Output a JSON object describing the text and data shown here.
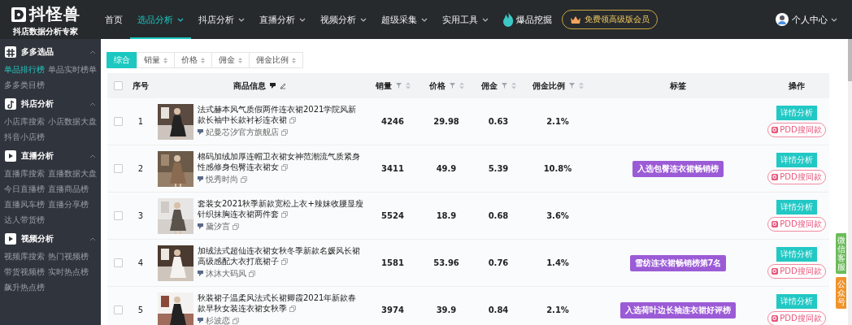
{
  "header": {
    "logo": {
      "title": "抖怪兽",
      "subtitle": "抖店数据分析专家"
    },
    "nav": [
      {
        "label": "首页",
        "selected": false,
        "dropdown": false
      },
      {
        "label": "选品分析",
        "selected": true,
        "dropdown": true
      },
      {
        "label": "抖店分析",
        "selected": false,
        "dropdown": true
      },
      {
        "label": "直播分析",
        "selected": false,
        "dropdown": true
      },
      {
        "label": "视频分析",
        "selected": false,
        "dropdown": true
      },
      {
        "label": "超级采集",
        "selected": false,
        "dropdown": true
      },
      {
        "label": "实用工具",
        "selected": false,
        "dropdown": true
      }
    ],
    "hot_link": "爆品挖掘",
    "vip_button": "免费领高级版会员",
    "user": "个人中心"
  },
  "sidebar": [
    {
      "title": "多多选品",
      "expanded": true,
      "items": [
        {
          "label": "单品排行榜",
          "selected": true
        },
        {
          "label": "单品实时榜单",
          "selected": false
        },
        {
          "label": "多多类目榜",
          "selected": false
        }
      ]
    },
    {
      "title": "抖店分析",
      "expanded": true,
      "items": [
        {
          "label": "小店库搜索",
          "selected": false
        },
        {
          "label": "小店数据大盘",
          "selected": false
        },
        {
          "label": "抖音小店榜",
          "selected": false
        }
      ]
    },
    {
      "title": "直播分析",
      "expanded": true,
      "items": [
        {
          "label": "直播库搜索",
          "selected": false
        },
        {
          "label": "直播数据大盘",
          "selected": false
        },
        {
          "label": "今日直播榜",
          "selected": false
        },
        {
          "label": "直播商品榜",
          "selected": false
        },
        {
          "label": "直播风车榜",
          "selected": false
        },
        {
          "label": "直播分享榜",
          "selected": false
        },
        {
          "label": "达人带货榜",
          "selected": false
        }
      ]
    },
    {
      "title": "视频分析",
      "expanded": true,
      "items": [
        {
          "label": "视频库搜索",
          "selected": false
        },
        {
          "label": "热门视频榜",
          "selected": false
        },
        {
          "label": "带货视频榜",
          "selected": false
        },
        {
          "label": "实时热点榜",
          "selected": false
        },
        {
          "label": "飙升热点榜",
          "selected": false
        }
      ]
    }
  ],
  "sort_tabs": [
    {
      "label": "综合",
      "selected": true,
      "sortable": false
    },
    {
      "label": "销量",
      "selected": false,
      "sortable": true
    },
    {
      "label": "价格",
      "selected": false,
      "sortable": true
    },
    {
      "label": "佣金",
      "selected": false,
      "sortable": true
    },
    {
      "label": "佣金比例",
      "selected": false,
      "sortable": true
    }
  ],
  "table": {
    "all_checked": false,
    "columns": [
      {
        "label": "序号",
        "kind": "plain"
      },
      {
        "label": "商品信息",
        "kind": "info"
      },
      {
        "label": "销量",
        "kind": "filter"
      },
      {
        "label": "价格",
        "kind": "filter"
      },
      {
        "label": "佣金",
        "kind": "filter"
      },
      {
        "label": "佣金比例",
        "kind": "filter"
      },
      {
        "label": "标签",
        "kind": "plain"
      },
      {
        "label": "操作",
        "kind": "plain"
      }
    ],
    "rows": [
      {
        "checked": false,
        "index": "1",
        "title": "法式赫本风气质假两件连衣裙2021学院风新款长袖中长款衬衫连衣裙",
        "shop": "妃曼芯汐官方旗舰店",
        "sales": "4246",
        "price": "29.98",
        "commission": "0.63",
        "ratio": "2.1%",
        "actions": [
          "详情分析",
          "PDD搜同款"
        ]
      },
      {
        "checked": false,
        "index": "2",
        "title": "棉码加绒加厚连帽卫衣裙女神范潮流气质紧身性感修身包臀连衣裙女",
        "shop": "悦秀时尚",
        "sales": "3411",
        "price": "49.9",
        "commission": "5.39",
        "ratio": "10.8%",
        "tag": "入选包臀连衣裙畅销榜",
        "actions": [
          "详情分析",
          "PDD搜同款"
        ]
      },
      {
        "checked": false,
        "index": "3",
        "title": "套装女2021秋季新款宽松上衣+辣妹收腰显瘦针织抹胸连衣裙两件套",
        "shop": "黛汐言",
        "sales": "5524",
        "price": "18.9",
        "commission": "0.68",
        "ratio": "3.6%",
        "actions": [
          "详情分析",
          "PDD搜同款"
        ]
      },
      {
        "checked": false,
        "index": "4",
        "title": "加绒法式超仙连衣裙女秋冬季新款名媛风长裙高级感配大衣打底裙子",
        "shop": "沐沐大码风",
        "sales": "1581",
        "price": "53.96",
        "commission": "0.76",
        "ratio": "1.4%",
        "tag": "雪纺连衣裙畅销榜第7名",
        "actions": [
          "详情分析",
          "PDD搜同款"
        ]
      },
      {
        "checked": false,
        "index": "5",
        "title": "秋装裙子温柔风法式长裙卿霞2021年新款春款早秋女装连衣裙女秋季",
        "shop": "杉波恋",
        "sales": "3974",
        "price": "39.9",
        "commission": "0.84",
        "ratio": "2.1%",
        "tag": "入选荷叶边长袖连衣裙好评榜",
        "actions": [
          "详情分析",
          "PDD搜同款"
        ]
      }
    ]
  },
  "side_tabs": [
    {
      "label": "微信客服",
      "color": "#6cbb5a"
    },
    {
      "label": "公众号",
      "color": "#f0932b"
    }
  ]
}
